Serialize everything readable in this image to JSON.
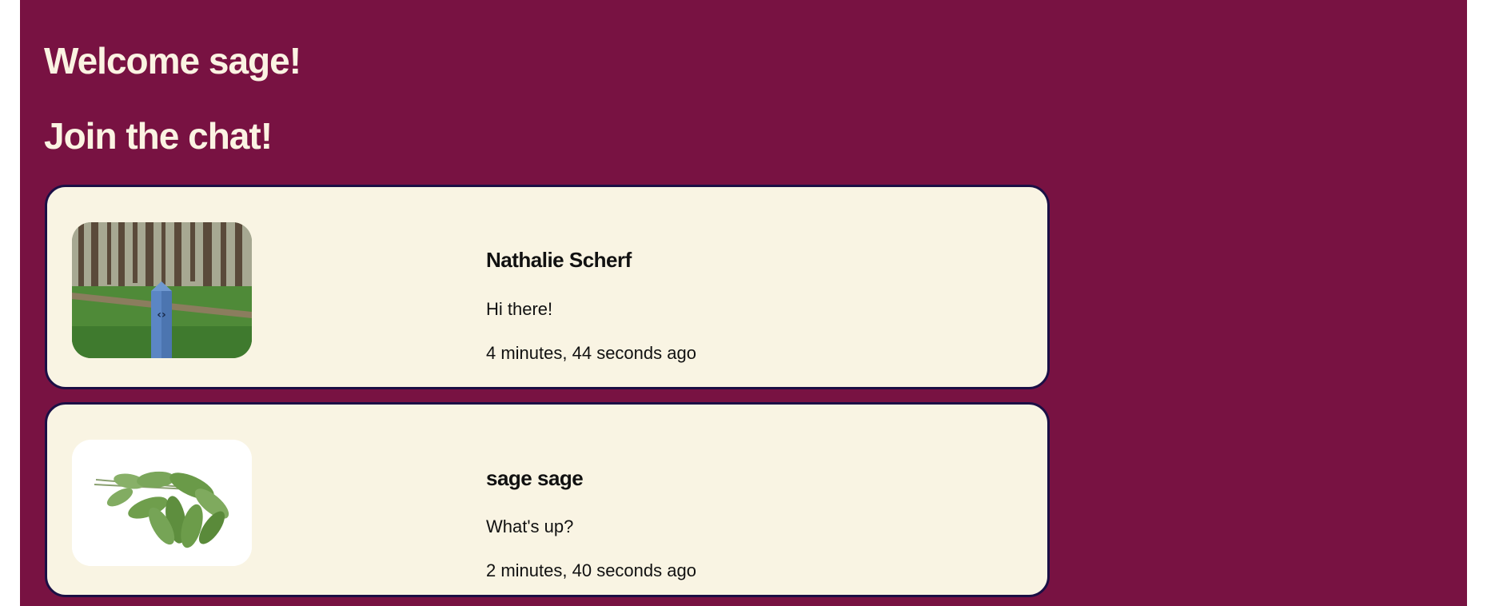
{
  "header": {
    "welcome": "Welcome sage!",
    "join": "Join the chat!"
  },
  "messages": [
    {
      "author": "Nathalie Scherf",
      "text": "Hi there!",
      "time": "4 minutes, 44 seconds ago",
      "avatar": "forest-signpost-photo"
    },
    {
      "author": "sage sage",
      "text": "What's up?",
      "time": "2 minutes, 40 seconds ago",
      "avatar": "sage-leaves-photo"
    }
  ],
  "colors": {
    "page_background": "#781242",
    "card_background": "#f9f4e3",
    "card_border": "#1b0f45",
    "heading_text": "#fbf3e2"
  }
}
